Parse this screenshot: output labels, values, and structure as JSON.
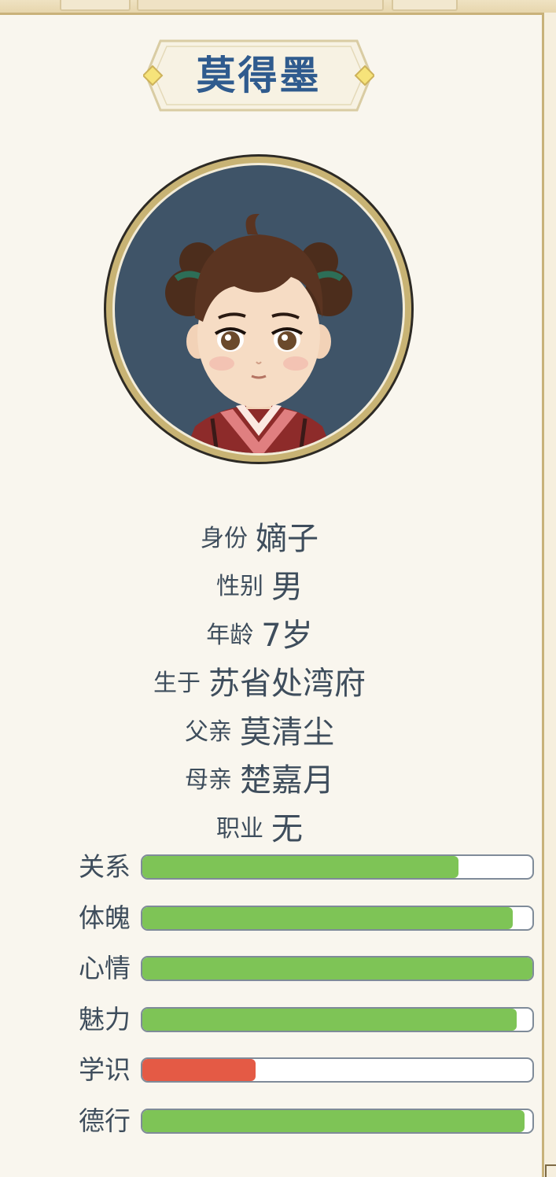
{
  "character": {
    "name": "莫得墨"
  },
  "info": [
    {
      "label": "身份",
      "value": "嫡子"
    },
    {
      "label": "性别",
      "value": "男"
    },
    {
      "label": "年龄",
      "value": "7岁"
    },
    {
      "label": "生于",
      "value": "苏省处湾府"
    },
    {
      "label": "父亲",
      "value": "莫清尘"
    },
    {
      "label": "母亲",
      "value": "楚嘉月"
    },
    {
      "label": "职业",
      "value": "无"
    }
  ],
  "stats": [
    {
      "label": "关系",
      "level": 0.81,
      "color": "#7ec456"
    },
    {
      "label": "体魄",
      "level": 0.95,
      "color": "#7ec456"
    },
    {
      "label": "心情",
      "level": 1.0,
      "color": "#7ec456"
    },
    {
      "label": "魅力",
      "level": 0.96,
      "color": "#7ec456"
    },
    {
      "label": "学识",
      "level": 0.29,
      "color": "#e45a45"
    },
    {
      "label": "德行",
      "level": 0.98,
      "color": "#7ec456"
    }
  ],
  "colors": {
    "name_text": "#2f5b8e",
    "portrait_bg": "#3f5468",
    "portrait_ring": "#c8b374"
  }
}
